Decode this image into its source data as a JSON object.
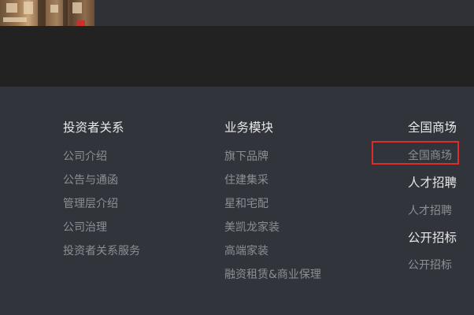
{
  "footer": {
    "investor": {
      "title": "投资者关系",
      "links": [
        "公司介绍",
        "公告与通函",
        "管理层介绍",
        "公司治理",
        "投资者关系服务"
      ]
    },
    "business": {
      "title": "业务模块",
      "links": [
        "旗下品牌",
        "住建集采",
        "星和宅配",
        "美凯龙家装",
        "高端家装",
        "融资租赁&商业保理"
      ]
    },
    "mall": {
      "title": "全国商场",
      "link": "全国商场"
    },
    "talent": {
      "title": "人才招聘",
      "link": "人才招聘"
    },
    "tender": {
      "title": "公开招标",
      "link": "公开招标"
    }
  },
  "colors": {
    "footer_bg": "#31353b",
    "band_bg": "#222222",
    "heading": "#e8e8e8",
    "link": "#8c8f94",
    "highlight": "#e02b2b"
  }
}
